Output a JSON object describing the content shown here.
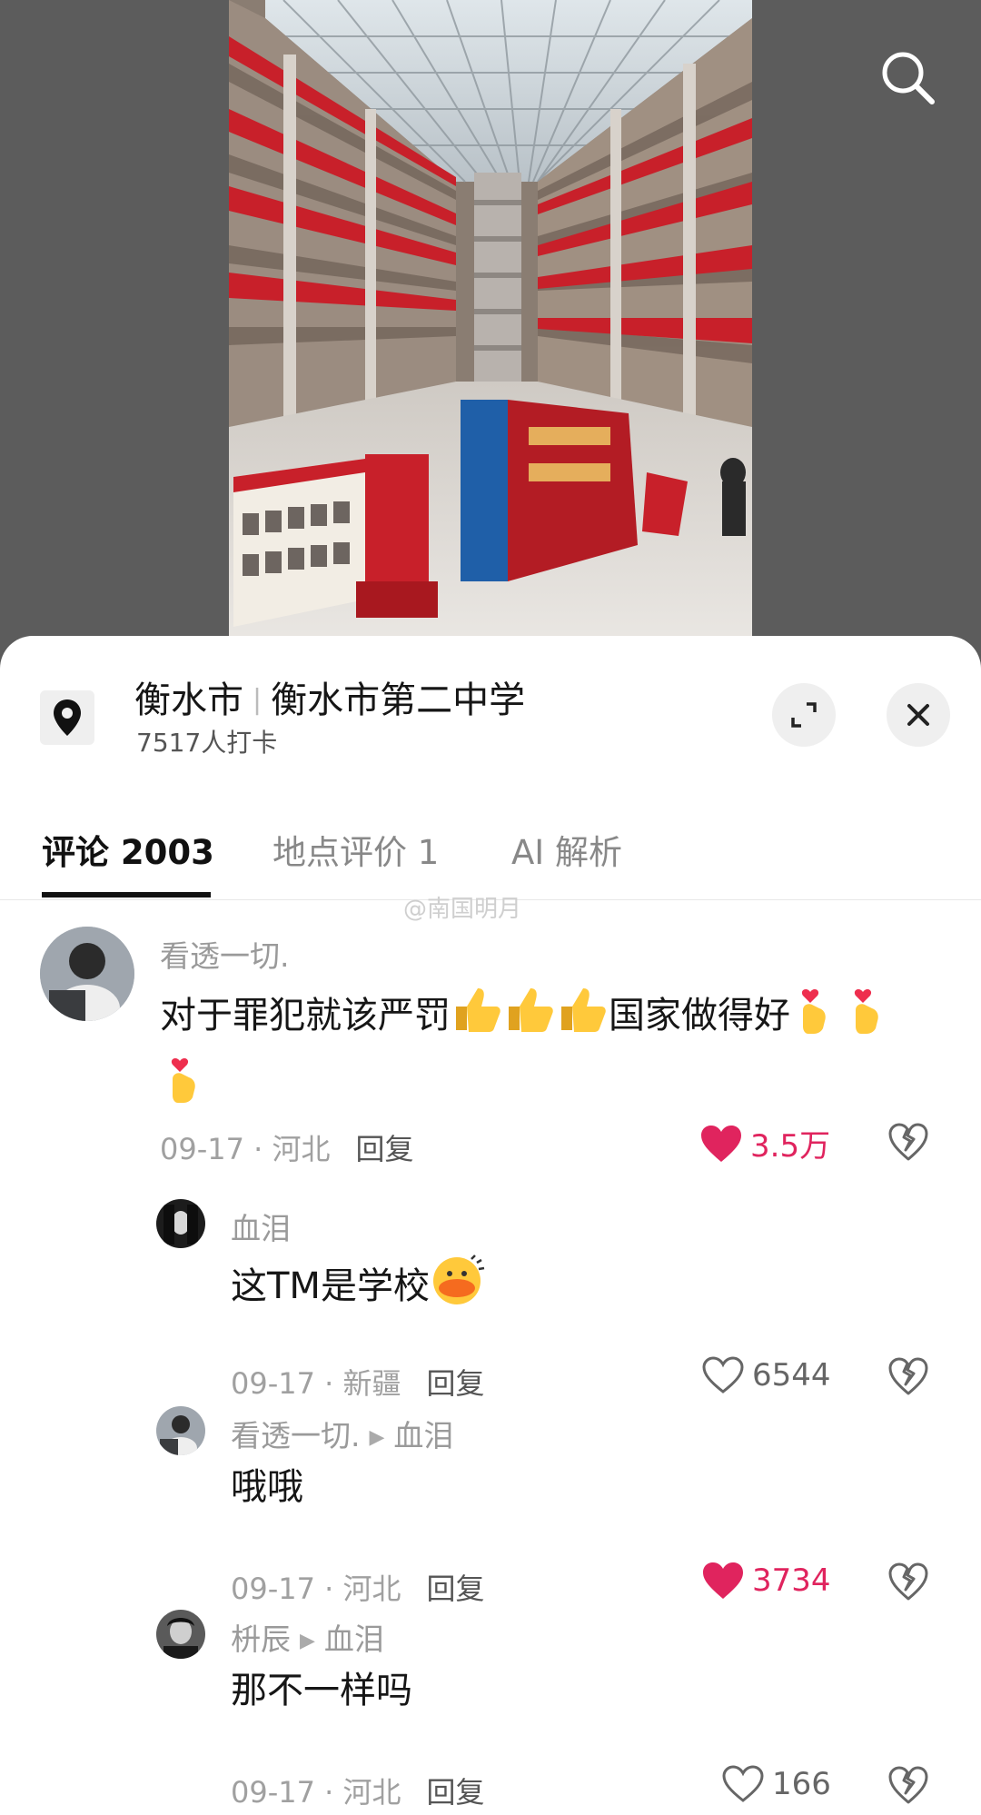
{
  "location": {
    "city": "衡水市",
    "place": "衡水市第二中学",
    "checkins": "7517人打卡"
  },
  "tabs": [
    {
      "label": "评论 2003"
    },
    {
      "label": "地点评价 1"
    },
    {
      "label": "AI 解析"
    }
  ],
  "watermark": "@南国明月",
  "comments": [
    {
      "user": "看透一切.",
      "text": "对于罪犯就该严罚",
      "text_tail": "国家做得好",
      "date": "09-17",
      "region": "河北",
      "reply_label": "回复",
      "likes": "3.5万",
      "liked": true
    },
    {
      "user": "血泪",
      "text": "这TM是学校",
      "date": "09-17",
      "region": "新疆",
      "reply_label": "回复",
      "likes": "6544",
      "liked": false
    },
    {
      "user": "看透一切.",
      "reply_to": "血泪",
      "text": "哦哦",
      "date": "09-17",
      "region": "河北",
      "reply_label": "回复",
      "likes": "3734",
      "liked": true
    },
    {
      "user": "枡辰",
      "reply_to": "血泪",
      "text": "那不一样吗",
      "date": "09-17",
      "region": "河北",
      "reply_label": "回复",
      "likes": "166",
      "liked": false
    }
  ],
  "colors": {
    "like_active": "#e0245e",
    "banner_red": "#c8202a",
    "sheet_bg": "#ffffff"
  },
  "icons": [
    "search-icon",
    "location-pin-icon",
    "expand-icon",
    "close-icon",
    "heart-icon",
    "broken-heart-icon",
    "thumbs-up-emoji",
    "finger-heart-emoji",
    "duck-emoji"
  ]
}
